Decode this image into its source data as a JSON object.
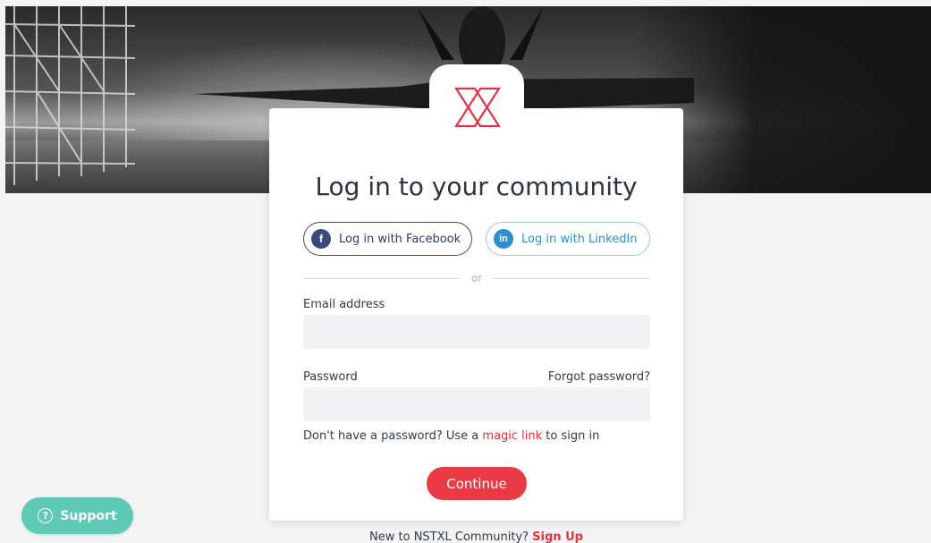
{
  "hero": {
    "image_name": "fighter-jet-hangar-photo"
  },
  "logo": {
    "icon": "x-logo-icon",
    "color": "#e0323f"
  },
  "title": "Log in to your community",
  "social": {
    "facebook": {
      "label": "Log in with Facebook",
      "icon": "f"
    },
    "linkedin": {
      "label": "Log in with LinkedIn",
      "icon": "in"
    }
  },
  "divider": {
    "text": "or"
  },
  "email": {
    "label": "Email address",
    "value": "",
    "placeholder": ""
  },
  "password": {
    "label": "Password",
    "value": "",
    "placeholder": "",
    "forgot": "Forgot password?"
  },
  "magic": {
    "prefix": "Don't have a password? Use a ",
    "link": "magic link",
    "suffix": " to sign in"
  },
  "continue_label": "Continue",
  "signup": {
    "prefix": "New to NSTXL Community? ",
    "link": "Sign Up"
  },
  "support": {
    "label": "Support",
    "icon": "?"
  },
  "colors": {
    "accent": "#ea3a45",
    "support": "#5ec9b4",
    "facebook": "#3b4a7a",
    "linkedin": "#2d8fd0"
  }
}
